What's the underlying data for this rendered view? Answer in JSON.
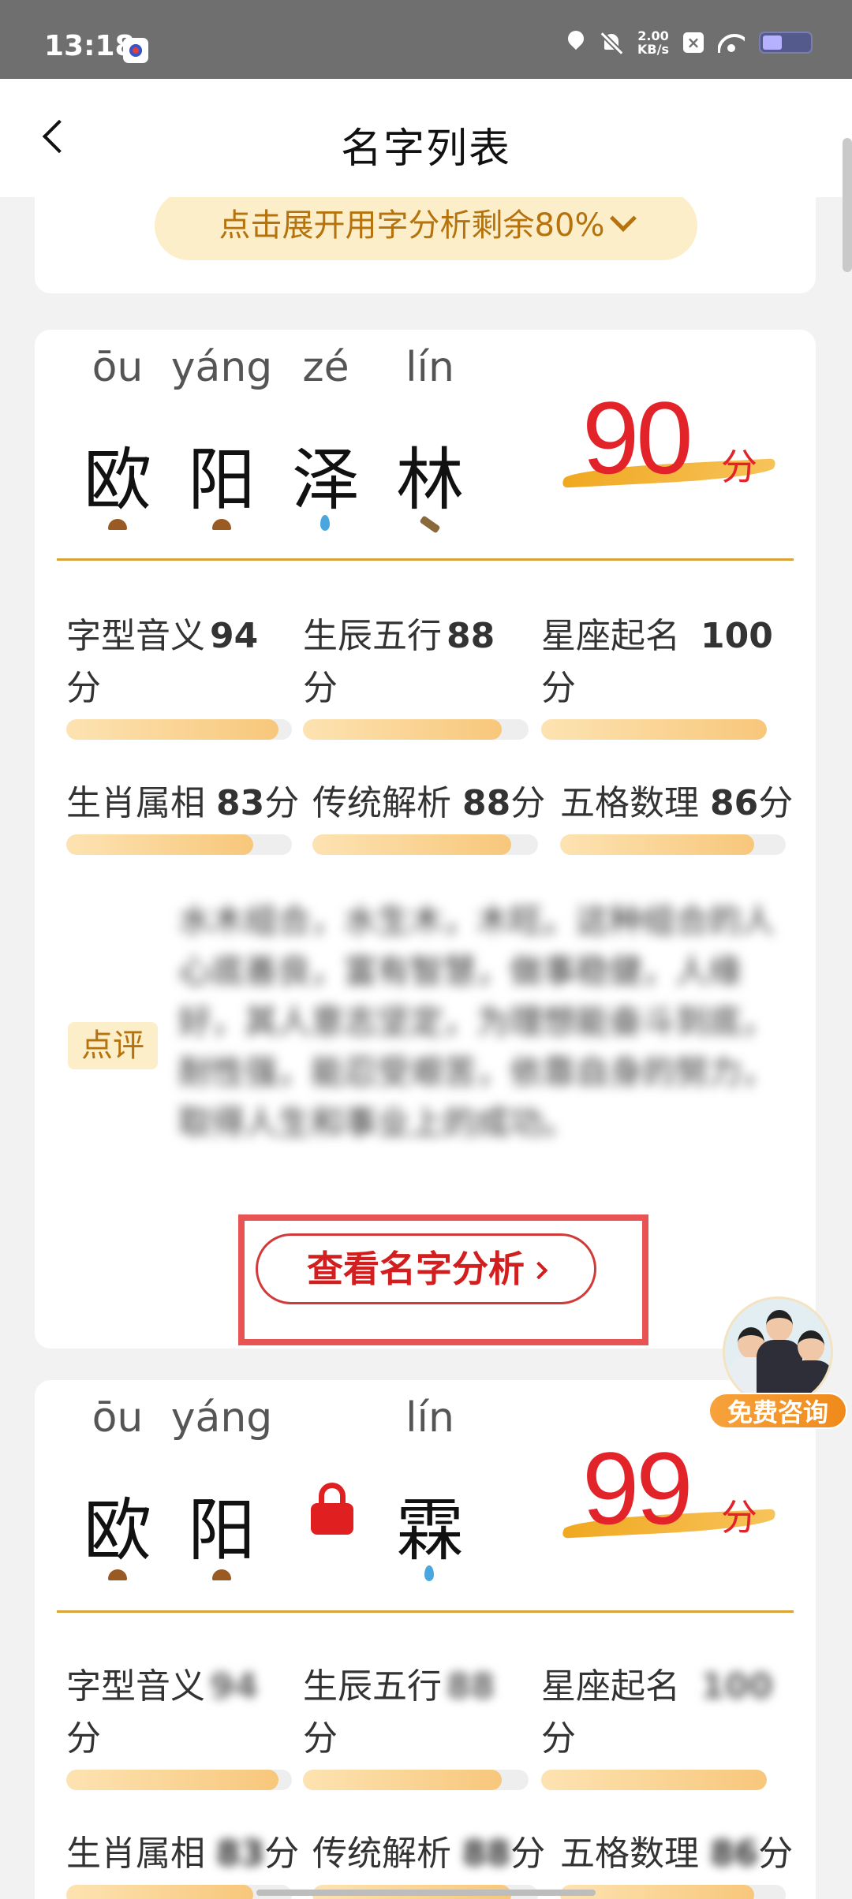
{
  "status_bar": {
    "time": "13:18",
    "speed_value": "2.00",
    "speed_unit": "KB/s"
  },
  "header": {
    "title": "名字列表"
  },
  "expand_bar": {
    "label": "点击展开用字分析剩余80%"
  },
  "cards": [
    {
      "chars": [
        {
          "pinyin": "ōu",
          "hanzi": "欧",
          "element": "earth"
        },
        {
          "pinyin": "yáng",
          "hanzi": "阳",
          "element": "earth"
        },
        {
          "pinyin": "zé",
          "hanzi": "泽",
          "element": "water"
        },
        {
          "pinyin": "lín",
          "hanzi": "林",
          "element": "wood"
        }
      ],
      "score": "90",
      "score_unit": "分",
      "metrics": [
        {
          "label": "字型音义",
          "value": "94",
          "unit": "分",
          "level": 0.94
        },
        {
          "label": "生辰五行",
          "value": "88",
          "unit": "分",
          "level": 0.88
        },
        {
          "label": "星座起名",
          "value": "100",
          "unit": "分",
          "level": 1.0
        },
        {
          "label": "生肖属相",
          "value": "83",
          "unit": "分",
          "level": 0.83
        },
        {
          "label": "传统解析",
          "value": "88",
          "unit": "分",
          "level": 0.88
        },
        {
          "label": "五格数理",
          "value": "86",
          "unit": "分",
          "level": 0.86
        }
      ],
      "comment_label": "点评",
      "comment_text": "水木组合，水生木，木旺。这种组合的人心底善良，富有智慧，做事稳健，人缘好，其人意志坚定，为理想能奋斗到底，耐性强，能忍受艰苦，依靠自身的努力，取得人生和事业上的成功。",
      "analyze_button": "查看名字分析"
    },
    {
      "chars": [
        {
          "pinyin": "ōu",
          "hanzi": "欧",
          "element": "earth"
        },
        {
          "pinyin": "yáng",
          "hanzi": "阳",
          "element": "earth"
        },
        {
          "pinyin": "",
          "hanzi": "",
          "element": "locked"
        },
        {
          "pinyin": "lín",
          "hanzi": "霖",
          "element": "water"
        }
      ],
      "score": "99",
      "score_unit": "分",
      "metrics": [
        {
          "label": "字型音义",
          "value": "94",
          "unit": "分",
          "level": 0.94
        },
        {
          "label": "生辰五行",
          "value": "88",
          "unit": "分",
          "level": 0.88
        },
        {
          "label": "星座起名",
          "value": "100",
          "unit": "分",
          "level": 1.0
        },
        {
          "label": "生肖属相",
          "value": "83",
          "unit": "分",
          "level": 0.83
        },
        {
          "label": "传统解析",
          "value": "88",
          "unit": "分",
          "level": 0.88
        },
        {
          "label": "五格数理",
          "value": "86",
          "unit": "分",
          "level": 0.86
        }
      ]
    }
  ],
  "consult": {
    "label": "免费咨询"
  }
}
